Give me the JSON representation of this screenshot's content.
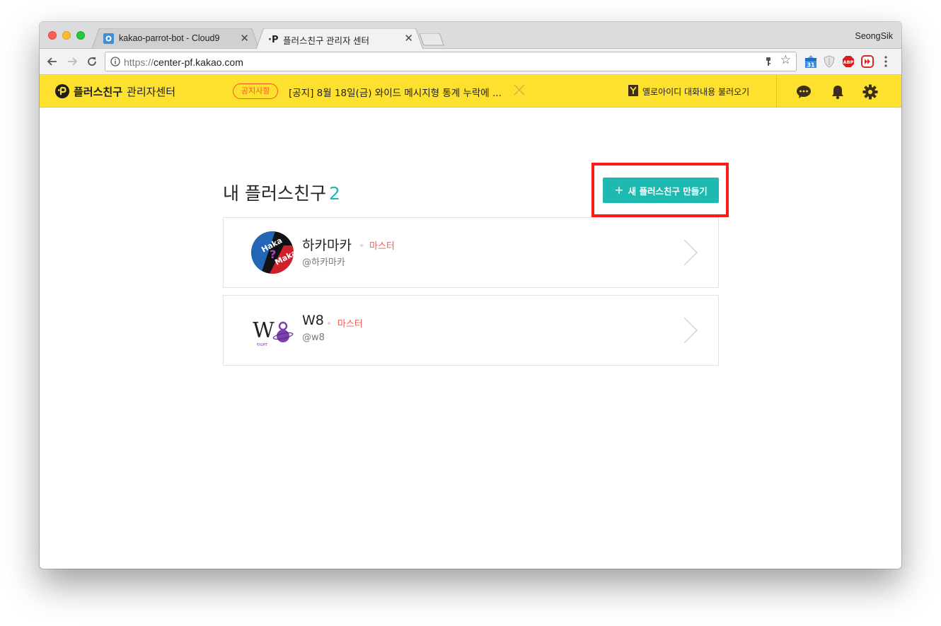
{
  "browser": {
    "profile_name": "SeongSik",
    "tabs": [
      {
        "title": "kakao-parrot-bot - Cloud9",
        "icon": "cloud9-icon",
        "active": false
      },
      {
        "title": "플러스친구 관리자 센터",
        "icon": "plusfriend-icon",
        "active": true
      }
    ],
    "url_scheme": "https://",
    "url_host": "center-pf.kakao.com",
    "extension_badge": "31",
    "abp_label": "ABP"
  },
  "header": {
    "logo_strong": "플러스친구",
    "logo_light": "관리자센터",
    "notice_badge": "공지사항",
    "notice_text": "[공지] 8월 18일(금) 와이드 메시지형 통계 누락에 ...",
    "yello_link": "옐로아이디 대화내용 불러오기",
    "icons": [
      "chat-icon",
      "bell-icon",
      "gear-icon"
    ],
    "accent_color": "#fde12e"
  },
  "main": {
    "title": "내 플러스친구",
    "count": "2",
    "create_button": "새 플러스친구 만들기",
    "plus_symbol": "+",
    "accent_color": "#1ebab2",
    "highlight_color": "#ff1a1a",
    "friends": [
      {
        "name": "하카마카",
        "role": "마스터",
        "id": "@하카마카",
        "avatar_text_1": "Haka",
        "avatar_text_2": "Maka",
        "avatar_mark": "?"
      },
      {
        "name": "W8",
        "role": "마스터",
        "id": "@w8",
        "avatar_text_1": "W",
        "avatar_text_2": "EIGHT"
      }
    ]
  }
}
